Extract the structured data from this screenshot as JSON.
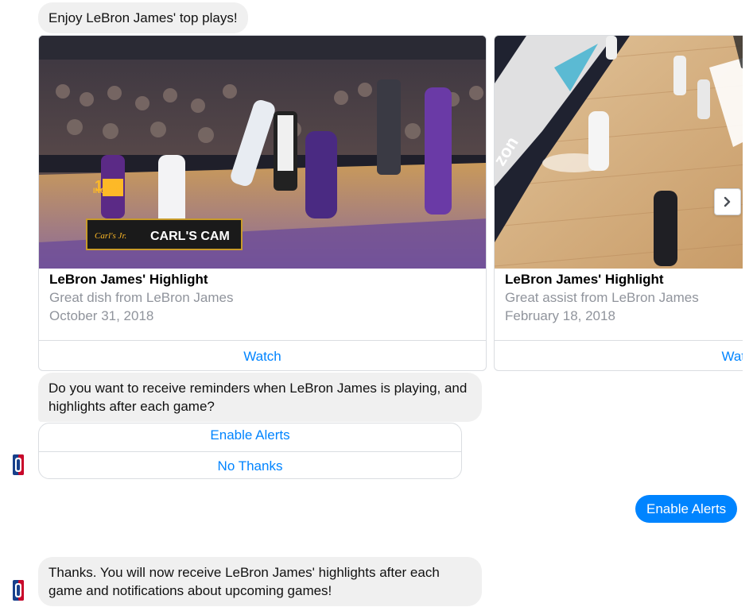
{
  "messages": {
    "intro": "Enjoy LeBron James' top plays!",
    "question": "Do you want to receive reminders when LeBron James is playing, and highlights after each game?",
    "user_reply": "Enable Alerts",
    "confirmation": "Thanks. You will now receive LeBron James' highlights after each game and notifications about upcoming games!"
  },
  "cards": [
    {
      "title": "LeBron James' Highlight",
      "subtitle": "Great dish from LeBron James",
      "date": "October 31, 2018",
      "button": "Watch",
      "overlay_brand": "Carl's Jr.",
      "overlay_text": "CARL'S CAM",
      "jersey_number": "14",
      "jersey_name": "INGRAM"
    },
    {
      "title": "LeBron James' Highlight",
      "subtitle": "Great assist from LeBron James",
      "date": "February 18, 2018",
      "button": "Watch",
      "court_text": "zon"
    }
  ],
  "quick_replies": [
    "Enable Alerts",
    "No Thanks"
  ],
  "icons": {
    "next": "chevron-right-icon",
    "avatar": "nba-logo-icon"
  },
  "colors": {
    "accent": "#0084ff",
    "bubble_gray": "#f0f0f0",
    "muted_text": "#90949c",
    "nba_red": "#c9082a",
    "nba_blue": "#17408b"
  }
}
